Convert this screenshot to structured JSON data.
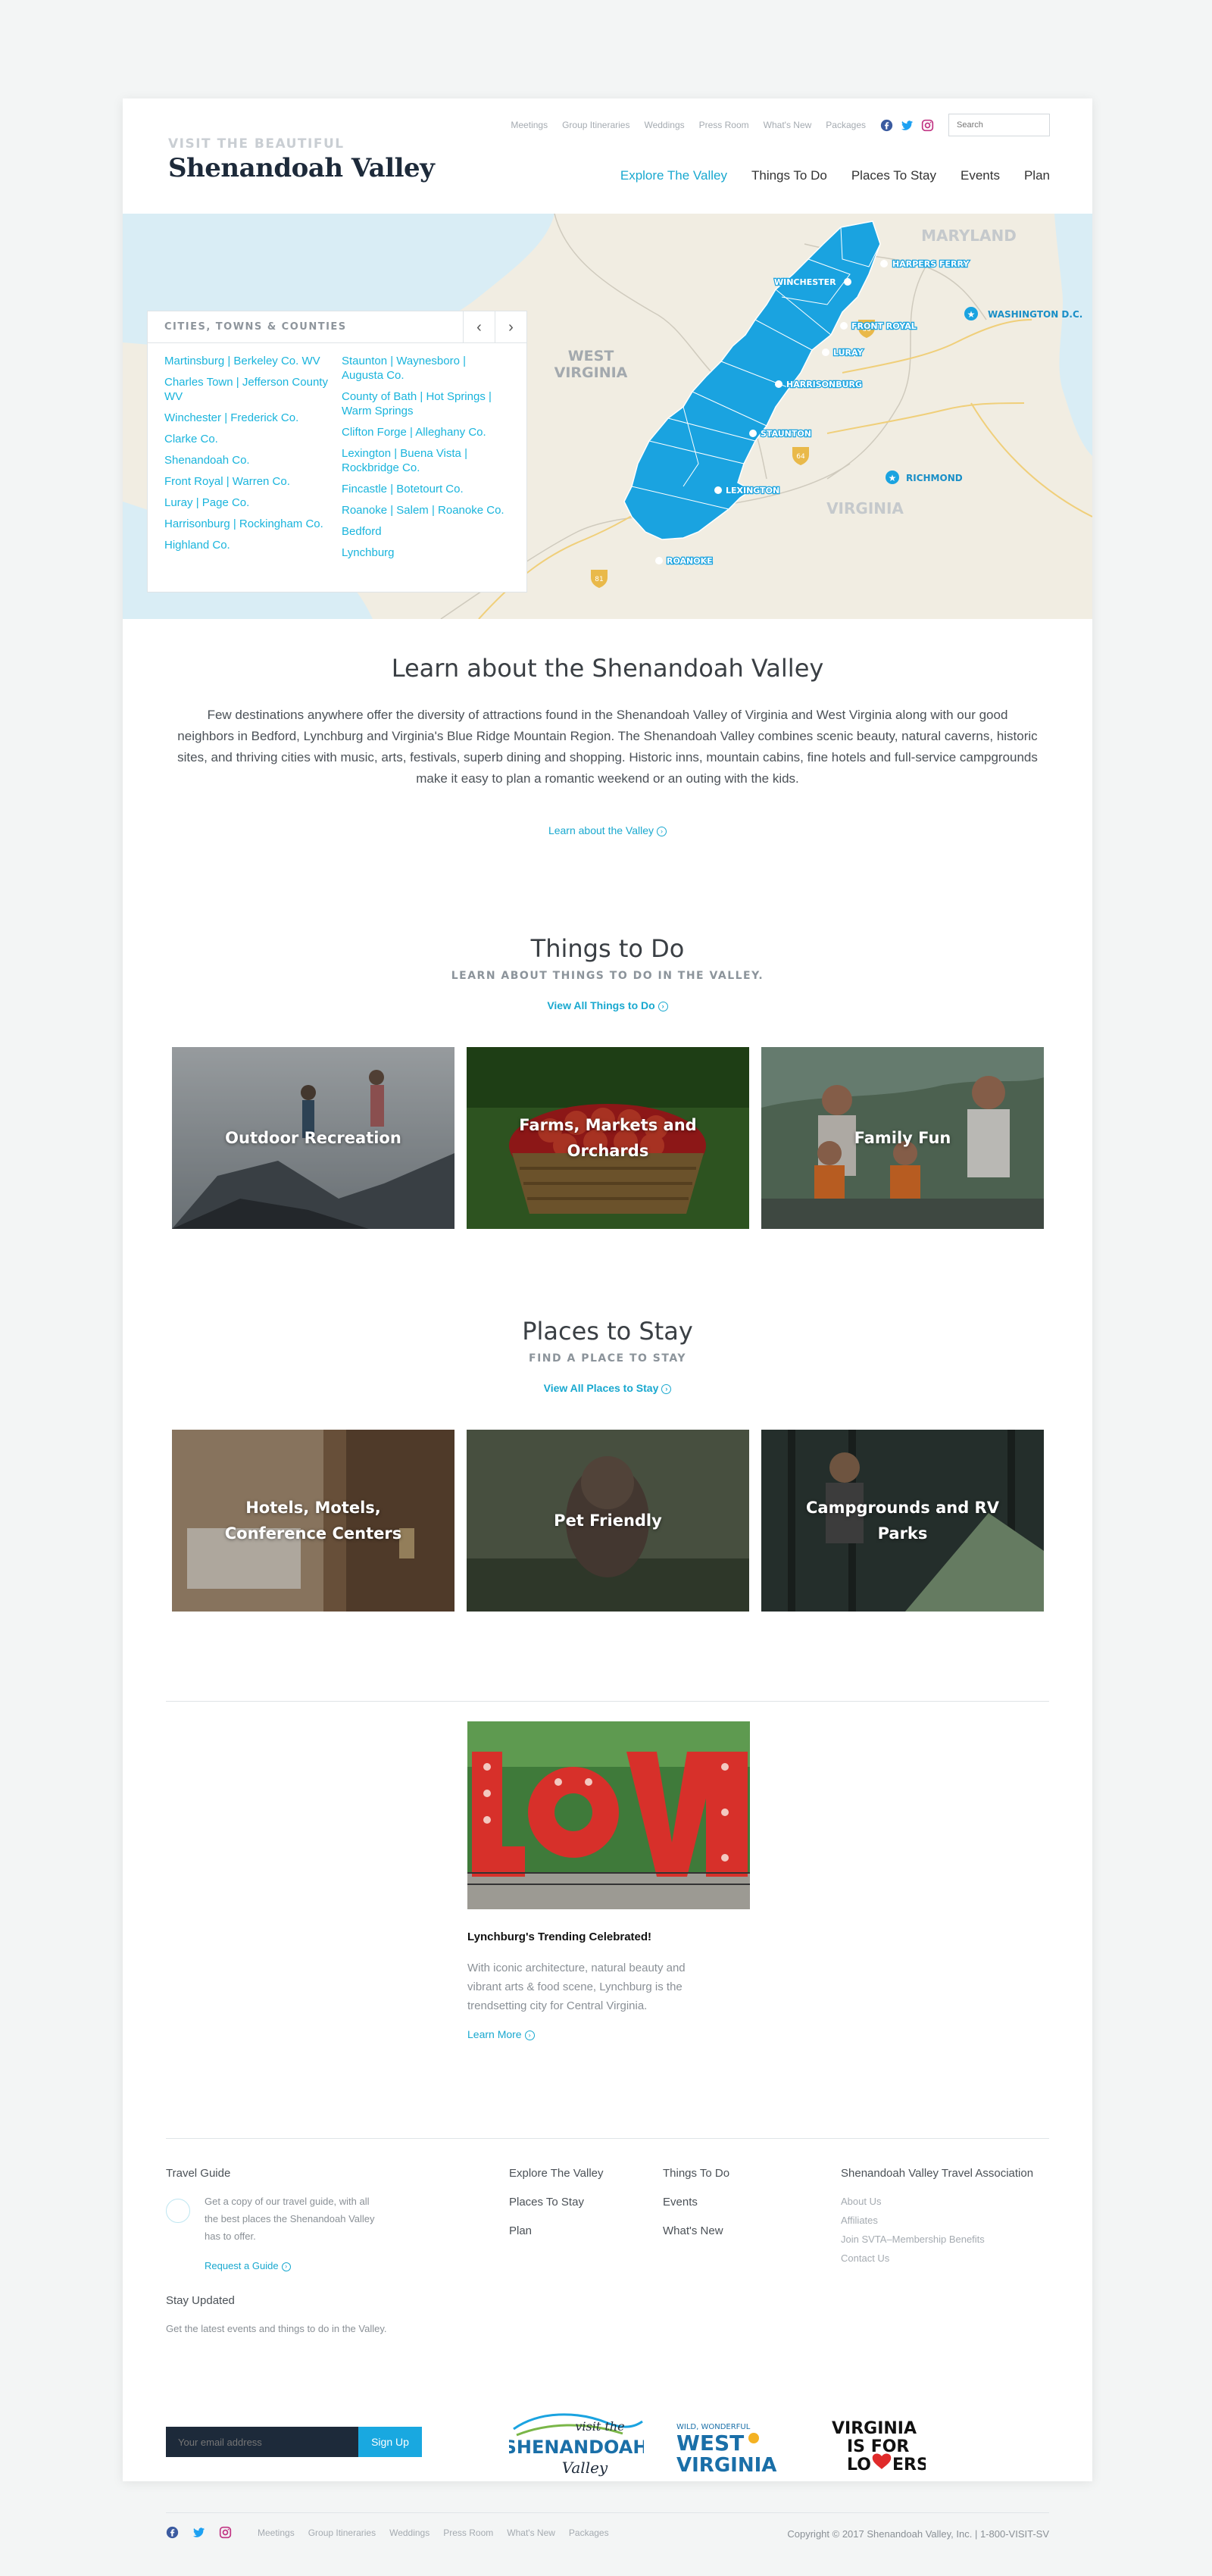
{
  "brand": {
    "tagline": "VISIT THE BEAUTIFUL",
    "name": "Shenandoah Valley"
  },
  "util_nav": [
    "Meetings",
    "Group Itineraries",
    "Weddings",
    "Press Room",
    "What's New",
    "Packages"
  ],
  "search": {
    "placeholder": "Search"
  },
  "main_nav": [
    "Explore The Valley",
    "Things To Do",
    "Places To Stay",
    "Events",
    "Plan"
  ],
  "map": {
    "labels": {
      "maryland": "MARYLAND",
      "west_virginia_1": "WEST",
      "west_virginia_2": "VIRGINIA",
      "virginia": "VIRGINIA",
      "washington": "WASHINGTON D.C.",
      "richmond": "RICHMOND",
      "harpers_ferry": "HARPERS FERRY",
      "winchester": "WINCHESTER",
      "front_royal": "FRONT ROYAL",
      "luray": "LURAY",
      "harrisonburg": "HARRISONBURG",
      "staunton": "STAUNTON",
      "lexington": "LEXINGTON",
      "roanoke": "ROANOKE"
    },
    "interstates": [
      "66",
      "64",
      "81"
    ]
  },
  "cities": {
    "heading": "CITIES, TOWNS & COUNTIES",
    "col1": [
      "Martinsburg | Berkeley Co. WV",
      "Charles Town | Jefferson County WV",
      "Winchester | Frederick Co.",
      "Clarke Co.",
      "Shenandoah Co.",
      "Front Royal | Warren Co.",
      "Luray | Page Co.",
      "Harrisonburg | Rockingham Co.",
      "Highland Co."
    ],
    "col2": [
      "Staunton | Waynesboro | Augusta Co.",
      "County of Bath | Hot Springs | Warm Springs",
      "Clifton Forge | Alleghany Co.",
      "Lexington | Buena Vista | Rockbridge Co.",
      "Fincastle | Botetourt Co.",
      "Roanoke | Salem | Roanoke Co.",
      "Bedford",
      "Lynchburg"
    ]
  },
  "learn": {
    "title": "Learn about the Shenandoah Valley",
    "text": "Few destinations anywhere offer the diversity of attractions found in the Shenandoah Valley of Virginia and West Virginia along with our good neighbors in Bedford, Lynchburg and Virginia's Blue Ridge Mountain Region. The Shenandoah Valley combines scenic beauty, natural caverns, historic sites, and thriving cities with music, arts, festivals, superb dining and shopping. Historic inns, mountain cabins, fine hotels and full-service campgrounds make it easy to plan a romantic weekend or an outing with the kids.",
    "link": "Learn about the Valley"
  },
  "things": {
    "title": "Things to Do",
    "subtitle": "LEARN ABOUT THINGS TO DO IN THE VALLEY.",
    "link": "View All Things to Do",
    "cards": [
      "Outdoor Recreation",
      "Farms, Markets and Orchards",
      "Family Fun"
    ]
  },
  "stay": {
    "title": "Places to Stay",
    "subtitle": "FIND A PLACE TO STAY",
    "link": "View All Places to Stay",
    "cards": [
      "Hotels, Motels, Conference Centers",
      "Pet Friendly",
      "Campgrounds and RV Parks"
    ]
  },
  "feature": {
    "title": "Lynchburg's Trending Celebrated!",
    "text": "With iconic architecture, natural beauty and vibrant arts & food scene, Lynchburg is the trendsetting city for Central Virginia.",
    "link": "Learn More"
  },
  "footer": {
    "guide_title": "Travel Guide",
    "guide_text": "Get a copy of our travel guide, with all the best places the Shenandoah Valley has to offer.",
    "guide_link": "Request a Guide",
    "links_col1": [
      "Explore The Valley",
      "Places To Stay",
      "Plan"
    ],
    "links_col2": [
      "Things To Do",
      "Events",
      "What's New"
    ],
    "assoc_title": "Shenandoah Valley Travel Association",
    "assoc_links": [
      "About Us",
      "Affiliates",
      "Join SVTA–Membership Benefits",
      "Contact Us"
    ],
    "updated_title": "Stay Updated",
    "updated_text": "Get the latest events and things to do in the Valley.",
    "email_placeholder": "Your email address",
    "signup": "Sign Up",
    "logo1_top": "visit the",
    "logo1_main": "SHENANDOAH",
    "logo1_bottom": "Valley",
    "logo2_top": "WILD, WONDERFUL",
    "logo2_line1": "WEST",
    "logo2_line2": "VIRGINIA",
    "logo3_line1": "VIRGINIA",
    "logo3_line2a": "IS FOR",
    "logo3_line3": "LO",
    "logo3_line3b": "ERS",
    "bottom_links": [
      "Meetings",
      "Group Itineraries",
      "Weddings",
      "Press Room",
      "What's New",
      "Packages"
    ],
    "copyright": "Copyright © 2017 Shenandoah Valley, Inc. | 1-800-VISIT-SV"
  },
  "colors": {
    "accent": "#19a8cf",
    "map_blue": "#1aa3e0",
    "navy": "#1d2a3a"
  }
}
